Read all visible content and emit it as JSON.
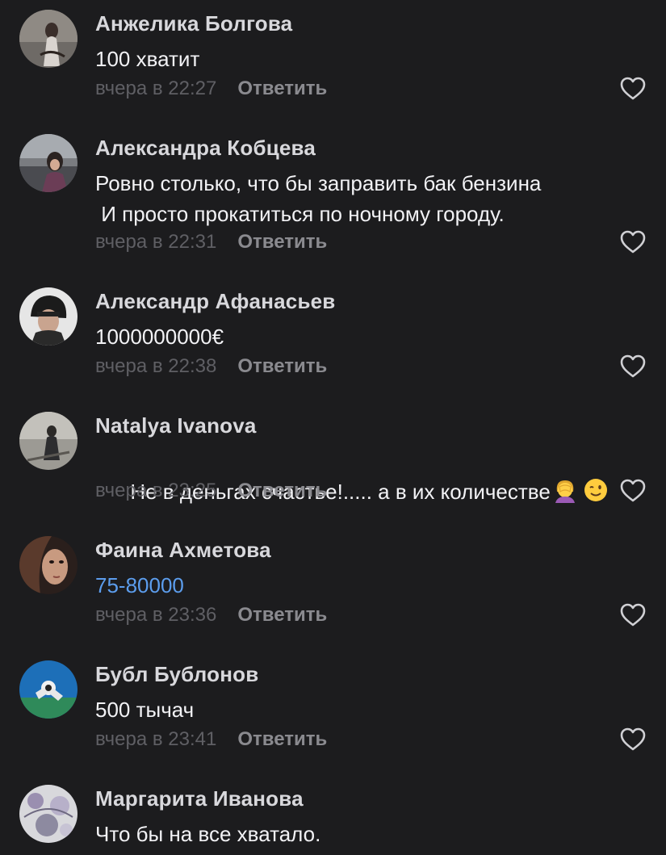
{
  "comments": [
    {
      "author": "Анжелика Болгова",
      "text": "100 хватит",
      "time": "вчера в 22:27",
      "reply": "Ответить",
      "avatar_icon": "avatar-photo-angelika"
    },
    {
      "author": "Александра Кобцева",
      "text": "Ровно столько, что бы заправить бак бензина\n И просто прокатиться по ночному городу.",
      "time": "вчера в 22:31",
      "reply": "Ответить",
      "avatar_icon": "avatar-photo-alexandra"
    },
    {
      "author": "Александр Афанасьев",
      "text": "1000000000€",
      "time": "вчера в 22:38",
      "reply": "Ответить",
      "avatar_icon": "avatar-photo-alexandr"
    },
    {
      "author": "Natalya Ivanova",
      "text": "Не в деньгах счастье!..... а в их количестве",
      "emojis": [
        "woman-facepalming-emoji",
        "winking-face-emoji"
      ],
      "time": "вчера в 23:25",
      "reply": "Ответить",
      "avatar_icon": "avatar-photo-natalya"
    },
    {
      "author": "Фаина Ахметова",
      "text": "75-80000",
      "text_style": "link",
      "time": "вчера в 23:36",
      "reply": "Ответить",
      "avatar_icon": "avatar-photo-faina"
    },
    {
      "author": "Бубл Бублонов",
      "text": "500 тычач",
      "time": "вчера в 23:41",
      "reply": "Ответить",
      "avatar_icon": "avatar-photo-bubl"
    },
    {
      "author": "Маргарита Иванова",
      "text": "Что бы на все хватало.",
      "time": "",
      "reply": "",
      "avatar_icon": "avatar-photo-margarita"
    }
  ],
  "colors": {
    "background": "#1c1c1e",
    "author": "#d8d8dc",
    "text": "#f2f2f5",
    "link": "#5c9ded",
    "time": "#5f5f64",
    "reply": "#8a8a8f",
    "heart_outline": "#d0d0d4"
  }
}
